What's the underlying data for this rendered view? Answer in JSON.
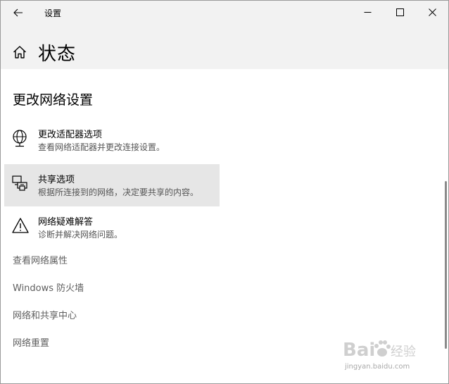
{
  "window": {
    "app_title": "设置",
    "page_title": "状态"
  },
  "icons": {
    "back": "back-arrow-icon",
    "minimize": "minimize-icon",
    "maximize": "maximize-icon",
    "close": "close-icon",
    "home": "home-icon"
  },
  "section": {
    "title": "更改网络设置"
  },
  "options": [
    {
      "title": "更改适配器选项",
      "desc": "查看网络适配器并更改连接设置。",
      "icon": "globe-network-icon"
    },
    {
      "title": "共享选项",
      "desc": "根据所连接到的网络，决定要共享的内容。",
      "icon": "sharing-icon",
      "hovered": true
    },
    {
      "title": "网络疑难解答",
      "desc": "诊断并解决网络问题。",
      "icon": "warning-icon"
    }
  ],
  "links": [
    {
      "label": "查看网络属性"
    },
    {
      "label": "Windows 防火墙"
    },
    {
      "label": "网络和共享中心"
    },
    {
      "label": "网络重置"
    }
  ],
  "colors": {
    "header_bg": "#f2f2f2",
    "hover_bg": "#e6e6e6",
    "link_text": "#5f5f5f"
  }
}
